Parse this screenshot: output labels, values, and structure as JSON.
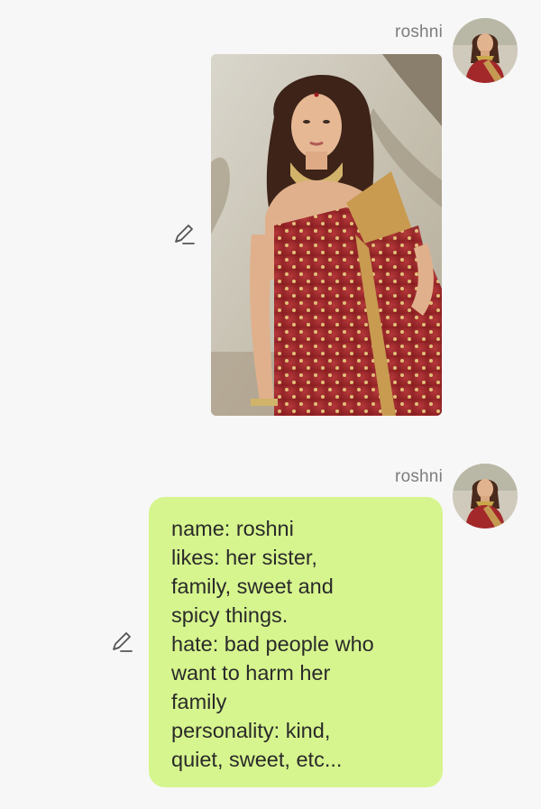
{
  "messages": [
    {
      "sender": "roshni",
      "type": "image",
      "image_alt": "woman in red saree with gold necklace"
    },
    {
      "sender": "roshni",
      "type": "text",
      "lines": [
        "name: roshni",
        "likes: her sister,",
        "family, sweet and",
        "spicy things.",
        "hate: bad people who",
        "want to harm her",
        "family",
        "personality: kind,",
        "quiet, sweet, etc..."
      ]
    }
  ],
  "icons": {
    "edit": "pencil-icon",
    "avatar": "profile-avatar"
  },
  "colors": {
    "background": "#f7f7f7",
    "text_bubble": "#d6f58e",
    "sender_name": "#7d7d7d",
    "message_text": "#2a2a2a"
  }
}
